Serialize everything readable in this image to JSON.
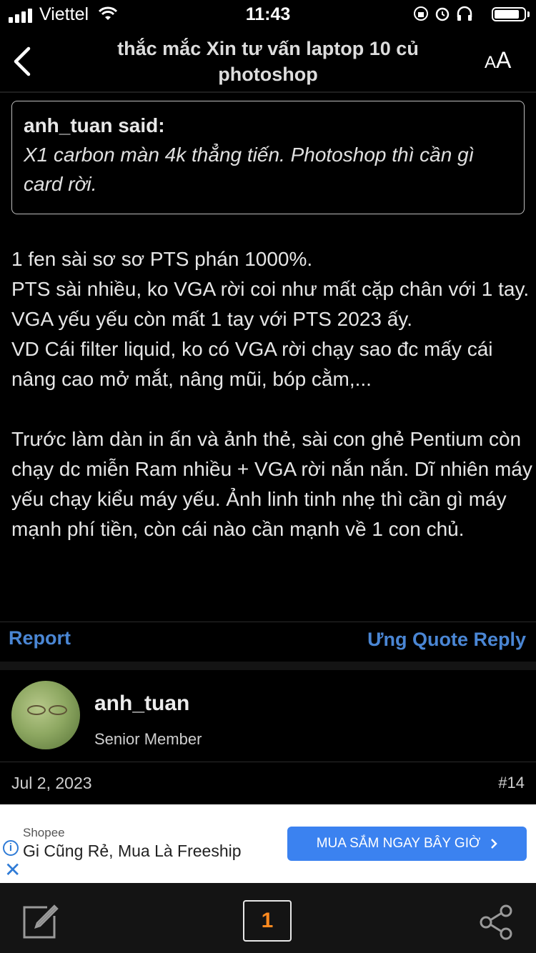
{
  "status": {
    "carrier": "Viettel",
    "time": "11:43"
  },
  "nav": {
    "title": "thắc mắc Xin tư vấn laptop 10 củ photoshop",
    "text_size": {
      "small": "A",
      "large": "A"
    }
  },
  "quote": {
    "author": "anh_tuan said:",
    "text": "X1 carbon màn 4k thẳng tiến. Photoshop thì cần gì card rời."
  },
  "post_body": {
    "lines": [
      "1 fen sài sơ sơ PTS phán 1000%.",
      "PTS sài nhiều, ko VGA rời coi như mất cặp chân với 1 tay.",
      "VGA yếu yếu còn mất 1 tay với PTS 2023 ấy.",
      "VD Cái filter liquid, ko có VGA rời chạy sao đc mấy cái nâng cao mở mắt, nâng mũi, bóp cằm,..."
    ],
    "paragraph2": "Trước làm dàn in ấn và ảnh thẻ, sài con ghẻ Pentium còn chạy dc miễn Ram nhiều + VGA rời nắn nắn. Dĩ nhiên máy yếu chạy kiểu máy yếu. Ảnh linh tinh nhẹ thì cần gì máy mạnh phí tiền, còn cái nào cần mạnh về 1 con chủ."
  },
  "actions": {
    "report": "Report",
    "right": "Ưng Quote Reply"
  },
  "next_post": {
    "username": "anh_tuan",
    "user_title": "Senior Member",
    "date": "Jul 2, 2023",
    "number": "#14"
  },
  "ad": {
    "brand": "Shopee",
    "headline": "Gi Cũng Rẻ, Mua Là Freeship",
    "button": "MUA SẮM NGAY BÂY GIỜ",
    "info_icon": "i",
    "close_icon": "✕"
  },
  "toolbar": {
    "page": "1"
  },
  "colors": {
    "link": "#4a86d4",
    "page_number": "#ff8a1f",
    "ad_button": "#3b82f0"
  }
}
